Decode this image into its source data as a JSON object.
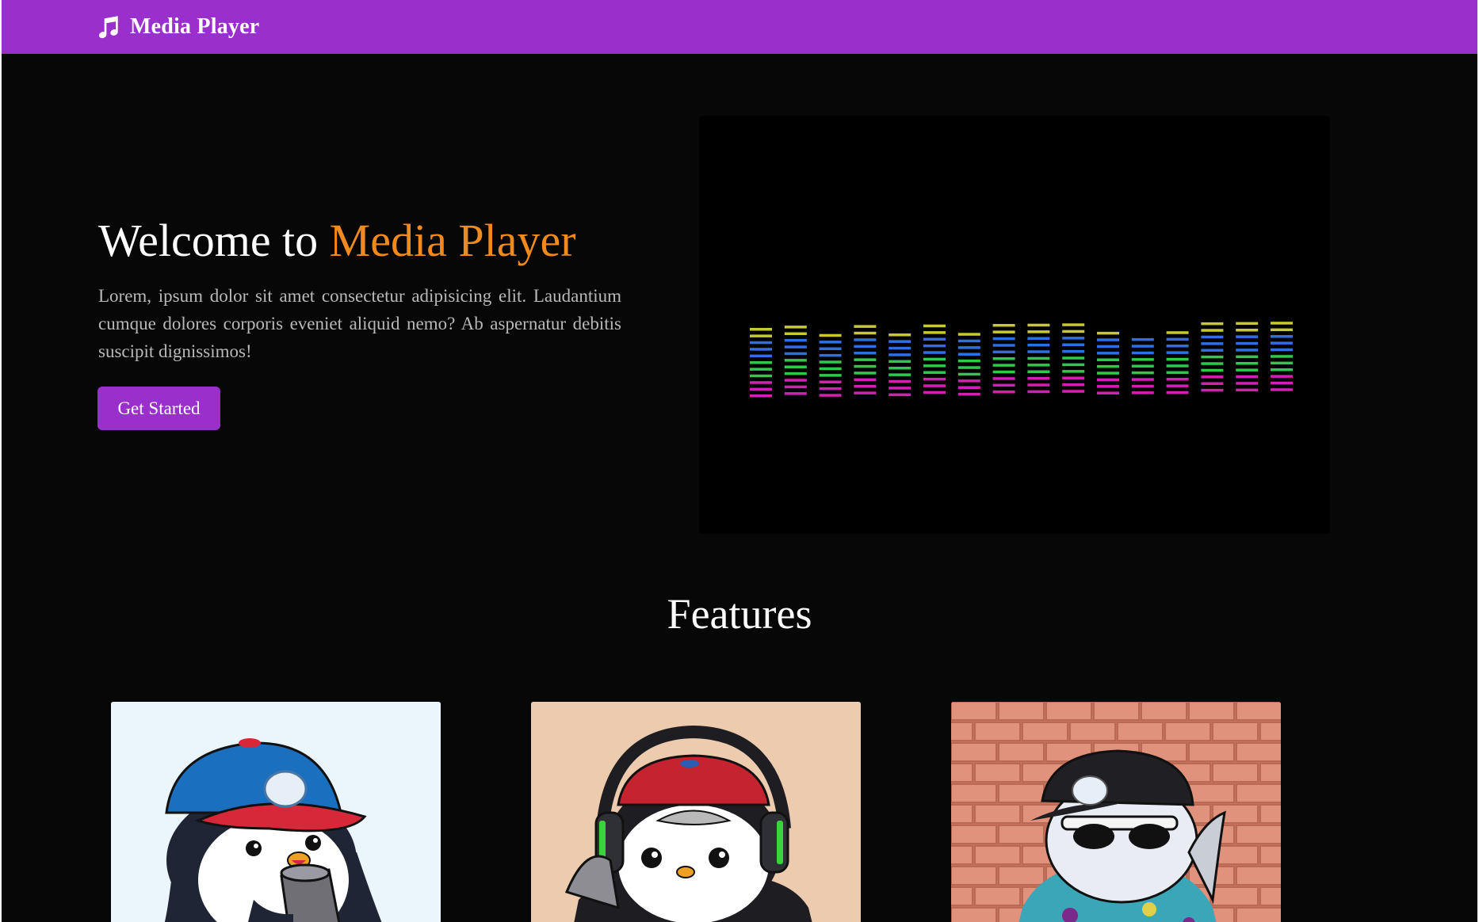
{
  "navbar": {
    "brand_text": "Media Player",
    "brand_icon": "music-note-icon",
    "color": "#9a30cc"
  },
  "hero": {
    "title_prefix": "Welcome to ",
    "title_highlight": "Media Player",
    "highlight_color": "#f08a1c",
    "description": "Lorem, ipsum dolor sit amet consectetur adipisicing elit. Laudantium cumque dolores corporis eveniet aliquid nemo? Ab aspernatur debitis suscipit dignissimos!",
    "cta_label": "Get Started"
  },
  "equalizer": {
    "bands": [
      {
        "height": 11,
        "offset": 0
      },
      {
        "height": 11,
        "offset": -1
      },
      {
        "height": 10,
        "offset": 0
      },
      {
        "height": 11,
        "offset": -1
      },
      {
        "height": 10,
        "offset": 0
      },
      {
        "height": 11,
        "offset": -1
      },
      {
        "height": 10,
        "offset": 0
      },
      {
        "height": 11,
        "offset": -1
      },
      {
        "height": 11,
        "offset": -1
      },
      {
        "height": 11,
        "offset": -1
      },
      {
        "height": 10,
        "offset": 0
      },
      {
        "height": 9,
        "offset": 0
      },
      {
        "height": 10,
        "offset": 0
      },
      {
        "height": 11,
        "offset": -1
      },
      {
        "height": 11,
        "offset": -1
      },
      {
        "height": 11,
        "offset": -1
      }
    ],
    "colors": [
      "#d21fb4",
      "#d21fb4",
      "#d21fb4",
      "#2ec84b",
      "#2ec84b",
      "#2ec84b",
      "#2f6fe2",
      "#2f6fe2",
      "#2f6fe2",
      "#c8c830",
      "#c8c830",
      "#c8c830"
    ]
  },
  "features": {
    "title": "Features",
    "cards": [
      {
        "name": "penguin-blue-cap-image",
        "background": "#eaf6fb"
      },
      {
        "name": "penguin-headphones-image",
        "background": "#eccbaf"
      },
      {
        "name": "penguin-sunglasses-image",
        "background": "#d9826b"
      }
    ]
  }
}
